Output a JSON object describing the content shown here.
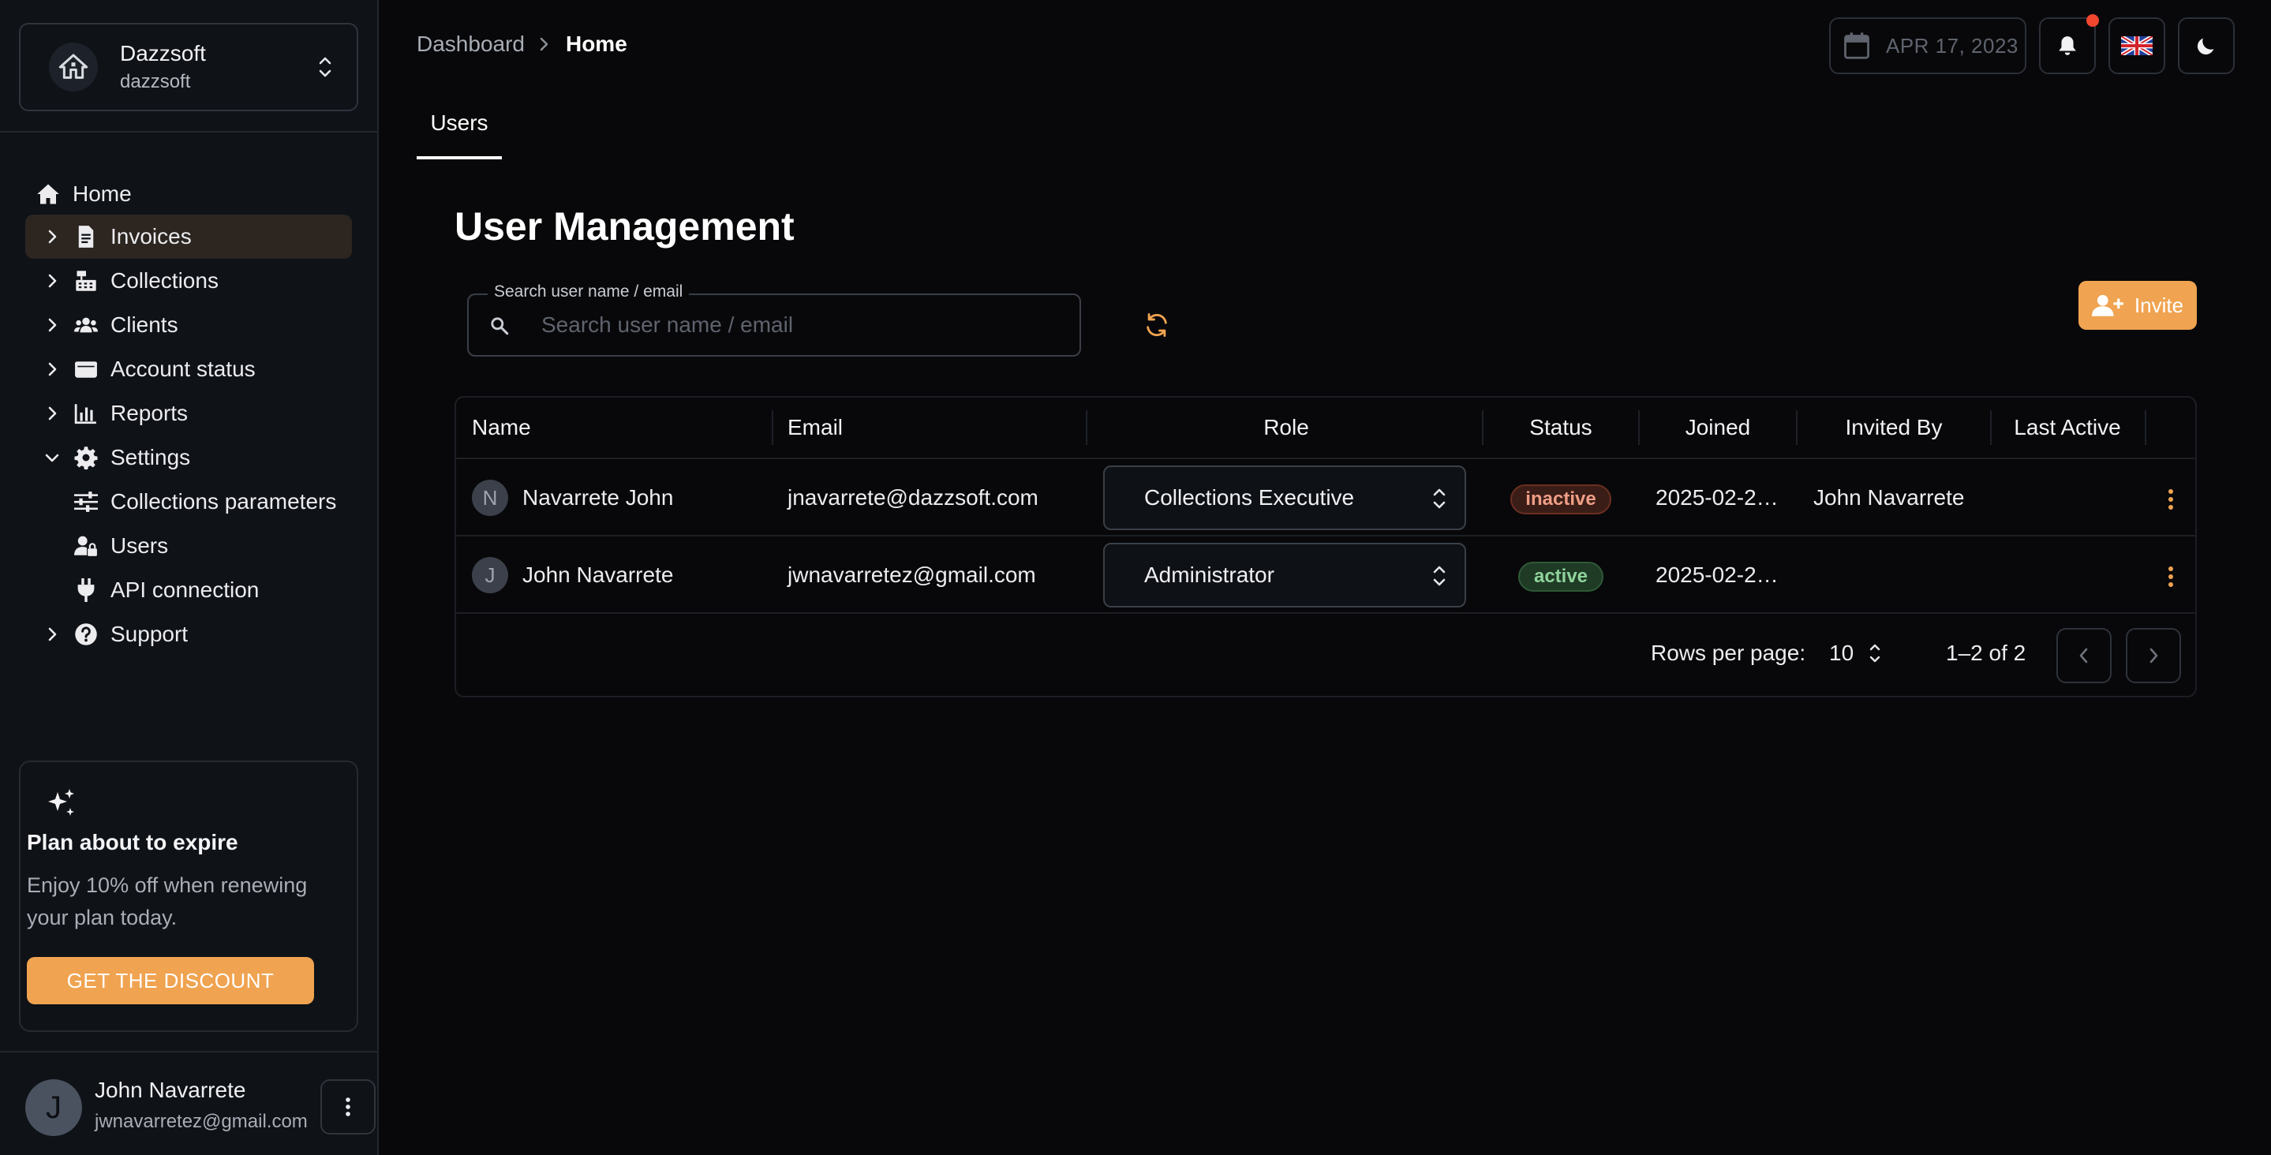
{
  "org": {
    "name": "Dazzsoft",
    "slug": "dazzsoft",
    "icon": "home-icon"
  },
  "nav": {
    "home": "Home",
    "invoices": "Invoices",
    "collections": "Collections",
    "clients": "Clients",
    "account_status": "Account status",
    "reports": "Reports",
    "settings": "Settings",
    "collections_parameters": "Collections parameters",
    "users": "Users",
    "api_connection": "API connection",
    "support": "Support"
  },
  "promo": {
    "title": "Plan about to expire",
    "text": "Enjoy 10% off when renewing your plan today.",
    "button": "GET THE DISCOUNT"
  },
  "current_user": {
    "initial": "J",
    "name": "John Navarrete",
    "email": "jwnavarretez@gmail.com"
  },
  "breadcrumb": {
    "parent": "Dashboard",
    "current": "Home"
  },
  "header": {
    "date": "APR 17, 2023",
    "flag": "🇬🇧"
  },
  "tabs": {
    "users": "Users"
  },
  "page": {
    "title": "User Management"
  },
  "search": {
    "label": "Search user name / email",
    "placeholder": "Search user name / email"
  },
  "invite": {
    "label": "Invite"
  },
  "table": {
    "headers": {
      "name": "Name",
      "email": "Email",
      "role": "Role",
      "status": "Status",
      "joined": "Joined",
      "invited_by": "Invited By",
      "last_active": "Last Active"
    },
    "rows": [
      {
        "initial": "N",
        "name": "Navarrete John",
        "email": "jnavarrete@dazzsoft.com",
        "role": "Collections Executive",
        "status": "inactive",
        "joined": "2025-02-2…",
        "invited_by": "John Navarrete",
        "last_active": ""
      },
      {
        "initial": "J",
        "name": "John Navarrete",
        "email": "jwnavarretez@gmail.com",
        "role": "Administrator",
        "status": "active",
        "joined": "2025-02-2…",
        "invited_by": "",
        "last_active": ""
      }
    ]
  },
  "pagination": {
    "rows_per_page_label": "Rows per page:",
    "rows_per_page": "10",
    "range": "1–2 of 2"
  },
  "colors": {
    "accent": "#f0a350",
    "active_nav": "#2c2520",
    "inactive_badge": "#3b1d17",
    "active_badge": "#1f3a25"
  }
}
